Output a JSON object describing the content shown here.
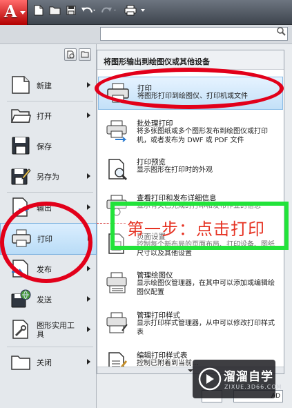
{
  "title_bar": {
    "app_logo_letter": "A",
    "quick_access": [
      {
        "name": "new-icon"
      },
      {
        "name": "open-icon"
      },
      {
        "name": "save-icon"
      },
      {
        "name": "undo-icon"
      },
      {
        "name": "redo-icon"
      },
      {
        "name": "print-icon"
      }
    ]
  },
  "search": {
    "placeholder": "",
    "value": "",
    "icon": "search-icon"
  },
  "left_menu": {
    "view_buttons": [
      {
        "name": "recent-documents-icon"
      },
      {
        "name": "open-documents-icon"
      }
    ],
    "items": [
      {
        "label": "新建",
        "icon": "new-document-icon",
        "has_submenu": true
      },
      {
        "label": "打开",
        "icon": "open-folder-icon",
        "has_submenu": true
      },
      {
        "label": "保存",
        "icon": "save-disk-icon",
        "has_submenu": false
      },
      {
        "label": "另存为",
        "icon": "save-as-icon",
        "has_submenu": true
      },
      {
        "label": "输出",
        "icon": "export-icon",
        "has_submenu": true
      },
      {
        "label": "打印",
        "icon": "printer-icon",
        "has_submenu": true,
        "active": true
      },
      {
        "label": "发布",
        "icon": "publish-icon",
        "has_submenu": true
      },
      {
        "label": "发送",
        "icon": "send-icon",
        "has_submenu": true
      },
      {
        "label": "图形实用工具",
        "icon": "drawing-utilities-icon",
        "has_submenu": true
      },
      {
        "label": "关闭",
        "icon": "close-folder-icon",
        "has_submenu": true
      }
    ]
  },
  "submenu": {
    "header": "将图形输出到绘图仪或其他设备",
    "items": [
      {
        "title": "打印",
        "description": "将图形打印到绘图仪、打印机或文件",
        "icon": "printer-icon",
        "active": true
      },
      {
        "title": "批处理打印",
        "description": "将多张图纸或多个图形发布到绘图仪或打印机，或者发布为 DWF 或 PDF 文件",
        "icon": "batch-plot-icon"
      },
      {
        "title": "打印预览",
        "description": "显示图形在打印时的外观",
        "icon": "plot-preview-icon"
      },
      {
        "title": "查看打印和发布详细信息",
        "description": "显示有关已完成的打印和发布作业的信息",
        "icon": "plot-details-icon"
      },
      {
        "title": "页面设置",
        "description": "控制每个新布局的页面布局、打印设备、图纸尺寸以及其他设置",
        "icon": "page-setup-icon"
      },
      {
        "title": "管理绘图仪",
        "description": "显示绘图仪管理器，在其中可以添加或编辑绘图仪配置",
        "icon": "plotter-manager-icon"
      },
      {
        "title": "管理打印样式",
        "description": "显示打印样式管理器，从中可以修改打印样式表",
        "icon": "plot-style-manager-icon"
      },
      {
        "title": "编辑打印样式表",
        "description": "控制已附着到当前...",
        "icon": "edit-plot-style-icon"
      }
    ]
  },
  "annotation": {
    "text": "第一步：点击打印",
    "color": "#e63323",
    "ring_color": "#e2001a",
    "box_color": "#22e33a"
  },
  "bottom_buttons": [
    "",
    "AD"
  ],
  "watermark": {
    "name": "溜溜自学",
    "url": "ZIXUE.3D66.COM"
  }
}
